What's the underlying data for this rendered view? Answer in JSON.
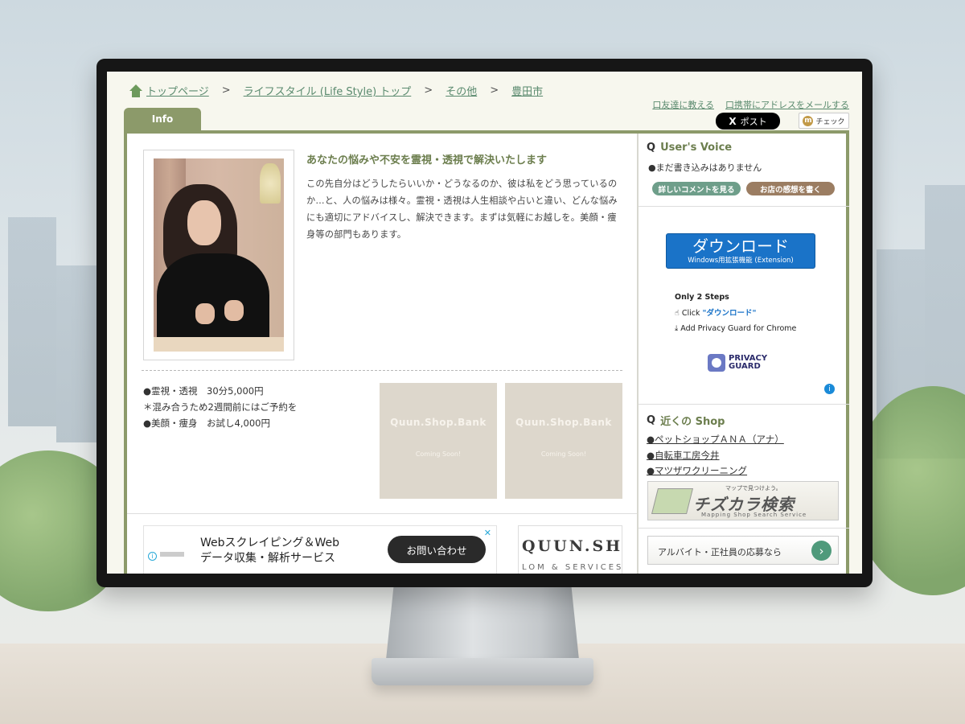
{
  "breadcrumb": {
    "items": [
      "トップページ",
      "ライフスタイル (Life Style) トップ",
      "その他",
      "豊田市"
    ],
    "separator": ">"
  },
  "top_links": {
    "tell_friend": "口友達に教える",
    "mail_mobile": "口携帯にアドレスをメールする"
  },
  "social": {
    "post_x": "X",
    "post_label": "ポスト",
    "check_m": "m",
    "check_label": "チェック"
  },
  "tabs": {
    "info": "Info"
  },
  "main": {
    "headline": "あなたの悩みや不安を霊視・透視で解決いたします",
    "description": "この先自分はどうしたらいいか・どうなるのか、彼は私をどう思っているのか…と、人の悩みは様々。霊視・透視は人生相談や占いと違い、どんな悩みにも適切にアドバイスし、解決できます。まずは気軽にお越しを。美顔・痩身等の部門もあります。",
    "menu": [
      "●霊視・透視　30分5,000円",
      "＊混み合うため2週間前にはご予約を",
      "●美顔・痩身　お試し4,000円"
    ],
    "placeholders": [
      {
        "title": "Quun.Shop.Bank",
        "sub": "Coming Soon!"
      },
      {
        "title": "Quun.Shop.Bank",
        "sub": "Coming Soon!"
      }
    ]
  },
  "ad": {
    "line1": "Webスクレイピング＆Web",
    "line2": "データ収集・解析サービス",
    "cta": "お問い合わせ"
  },
  "banner": {
    "title": "QUUN.SH",
    "sub": "LOM & SERVICES"
  },
  "sidebar": {
    "voice_title": "User's Voice",
    "q_mark": "Q",
    "voice_empty": "●まだ書き込みはありません",
    "btn_detail": "詳しいコメントを見る",
    "btn_review": "お店の感想を書く",
    "download": {
      "main": "ダウンロード",
      "sub": "Windows用拡張機能 (Extension)"
    },
    "steps_title": "Only 2 Steps",
    "step1_prefix": "Click ",
    "step1_highlight": "\"ダウンロード\"",
    "step2": "Add Privacy Guard for Chrome",
    "pg_line1": "PRIVACY",
    "pg_line2": "GUARD",
    "nearby_title": "近くの Shop",
    "shops": [
      "●ペットショップＡＮＡ（アナ）",
      "●自転車工房今井",
      "●マツザワクリーニング"
    ],
    "chizu_top": "マップで見つけよう。",
    "chizu_title": "チズカラ検索",
    "chizu_sub": "Mapping Shop Search Service",
    "job_text": "アルバイト・正社員の応募なら"
  },
  "colors": {
    "accent": "#8c9a6a",
    "link": "#5a8a6e",
    "download_blue": "#1a73c8",
    "pill_green": "#6e9e8a",
    "pill_brown": "#9b7d62"
  }
}
